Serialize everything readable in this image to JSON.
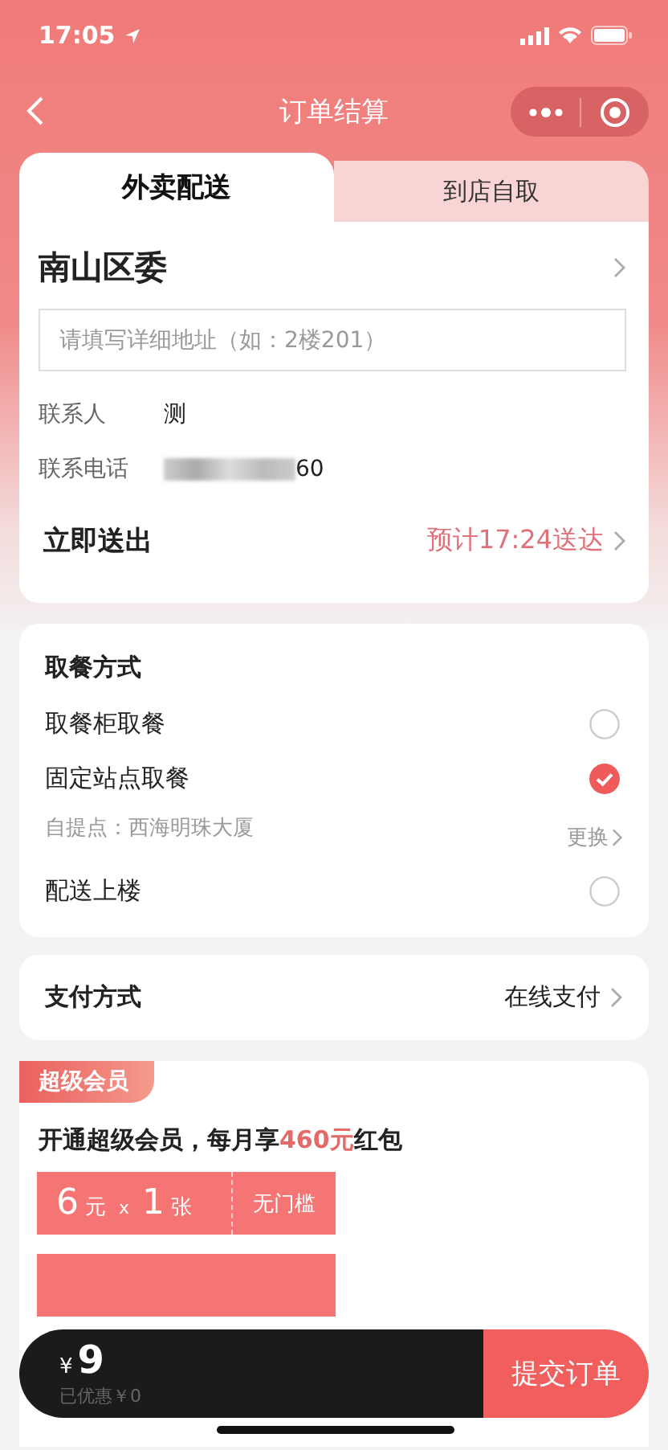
{
  "status_bar": {
    "time": "17:05"
  },
  "nav": {
    "title": "订单结算"
  },
  "tabs": [
    {
      "label": "外卖配送",
      "selected": true
    },
    {
      "label": "到店自取",
      "selected": false
    }
  ],
  "address": {
    "name": "南山区委",
    "detail_placeholder": "请填写详细地址（如：2楼201）"
  },
  "contact": [
    {
      "label": "联系人",
      "value": "测",
      "masked": false
    },
    {
      "label": "联系电话",
      "value": "60",
      "masked": true
    }
  ],
  "delivery": {
    "label": "立即送出",
    "estimate": "预计17:24送达"
  },
  "pickup": {
    "title": "取餐方式",
    "options": [
      {
        "label": "取餐柜取餐",
        "selected": false
      },
      {
        "label": "固定站点取餐",
        "selected": true,
        "detail": "自提点：西海明珠大厦",
        "action": "更换"
      },
      {
        "label": "配送上楼",
        "selected": false
      }
    ]
  },
  "payment": {
    "label": "支付方式",
    "value": "在线支付"
  },
  "membership": {
    "badge": "超级会员",
    "headline": "开通超级会员，每月享**460元**红包",
    "coupons": [
      {
        "amount": "6",
        "unit": "元",
        "times": "x",
        "count": "1",
        "count_unit": "张",
        "condition": "无门槛"
      },
      {
        "kind": "hidden"
      }
    ]
  },
  "checkout": {
    "currency": "¥",
    "total": "9",
    "discount": "已优惠￥0",
    "submit": "提交订单"
  }
}
